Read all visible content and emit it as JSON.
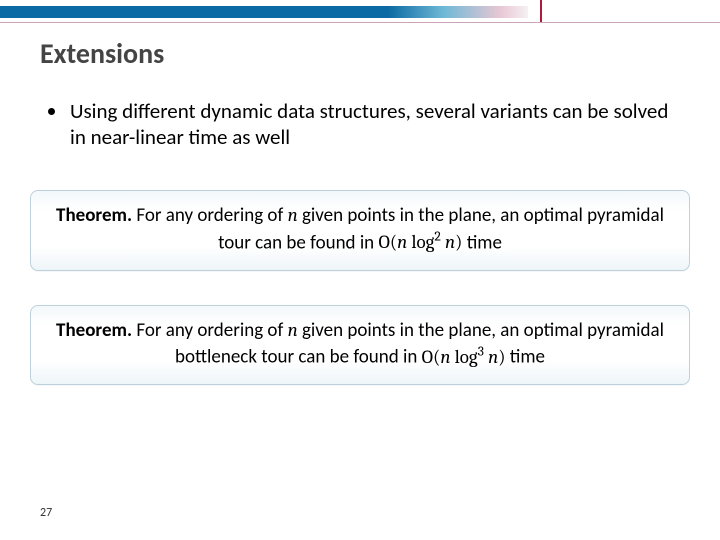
{
  "title": "Extensions",
  "bullet": "Using different dynamic data structures, several variants can be solved in near-linear time as well",
  "theorem_label": "Theorem.",
  "theorems": [
    {
      "prefix": "For any ordering of ",
      "n": "n",
      "middle": " given points in the plane, an optimal pyramidal tour can be found in ",
      "bigO_open": "O(",
      "bigO_inner_a": "n",
      "bigO_log": " log",
      "bigO_exp": "2",
      "bigO_inner_b": " n",
      "bigO_close": ")",
      "suffix": " time"
    },
    {
      "prefix": "For any ordering of ",
      "n": "n",
      "middle": " given points in the plane, an optimal pyramidal bottleneck tour can be found in ",
      "bigO_open": "O(",
      "bigO_inner_a": "n",
      "bigO_log": " log",
      "bigO_exp": "3",
      "bigO_inner_b": " n",
      "bigO_close": ")",
      "suffix": " time"
    }
  ],
  "page_number": "27"
}
